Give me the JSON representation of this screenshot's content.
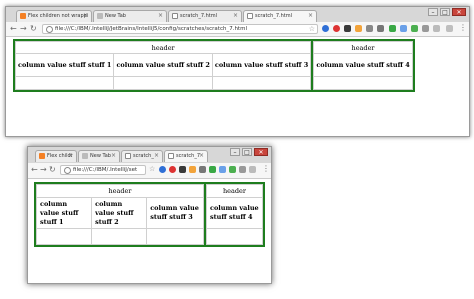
{
  "colors": {
    "outer_border": "#1e7d1e",
    "inner_border": "#d0d0d0",
    "close_button": "#c9463d"
  },
  "window_controls": {
    "minimize": "–",
    "restore": "□",
    "close": "✕"
  },
  "nav": {
    "back": "←",
    "forward": "→",
    "reload": "↻"
  },
  "windows": [
    {
      "tabs": [
        {
          "label": "Flex children not wrappi",
          "close": "×",
          "icon": "stackoverflow-icon"
        },
        {
          "label": "New Tab",
          "close": "×",
          "icon": "newtab-icon"
        },
        {
          "label": "scratch_7.html",
          "close": "×",
          "icon": "page-icon"
        },
        {
          "label": "scratch_7.html",
          "close": "×",
          "icon": "page-icon",
          "active": true
        }
      ],
      "url": "file:///C:/IBM/.IntelliJ/JetBrains/IntelliJ5/config/scratches/scratch_7.html",
      "table": {
        "left_header": "header",
        "right_header": "header",
        "cells": [
          "column value stuff stuff 1",
          "column value stuff stuff 2",
          "column value stuff stuff 3"
        ],
        "right_cell": "column value stuff stuff 4"
      }
    },
    {
      "tabs": [
        {
          "label": "Flex childr",
          "close": "×",
          "icon": "stackoverflow-icon"
        },
        {
          "label": "New Tab",
          "close": "×",
          "icon": "newtab-icon"
        },
        {
          "label": "scratch_",
          "close": "×",
          "icon": "page-icon"
        },
        {
          "label": "scratch_7",
          "close": "×",
          "icon": "page-icon",
          "active": true
        }
      ],
      "url": "file:///C:/IBM/.IntelliJ/set",
      "table": {
        "left_header": "header",
        "right_header": "header",
        "cells": [
          "column value stuff stuff 1",
          "column value stuff stuff 2",
          "column value stuff stuff 3"
        ],
        "right_cell": "column value stuff stuff 4"
      }
    }
  ]
}
